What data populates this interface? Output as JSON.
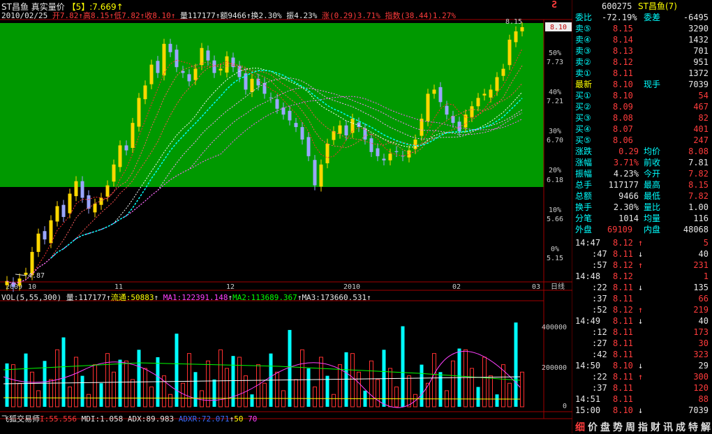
{
  "header": {
    "stock_name": "ST昌鱼",
    "mode": "真实量价",
    "bracket": "【5】",
    "bracket_val": ":7.669",
    "date": "2010/02/25",
    "open_l": "开",
    "open": "7.82",
    "high_l": "高",
    "high": "8.15",
    "low_l": "低",
    "low": "7.82",
    "close_l": "收",
    "close": "8.10",
    "vol_l": "量",
    "vol": "117177",
    "amt_l": "额",
    "amt": "9466",
    "turn_l": "换",
    "turn": "2.30%",
    "amp_l": "振",
    "amp": "4.23%",
    "chg_l": "涨",
    "chg": "(0.29)",
    "chg_pct": "3.71%",
    "idx_l": "指数",
    "idx": "(38.44)",
    "idx_pct": "1.27%"
  },
  "price_axis": {
    "labels": [
      "8.15",
      "7.73",
      "7.21",
      "6.70",
      "6.18",
      "5.66",
      "5.15"
    ],
    "pct": [
      "50%",
      "40%",
      "30%",
      "20%",
      "10%",
      "0%"
    ],
    "current": "8.10"
  },
  "date_axis": {
    "labels": [
      "2009",
      "10",
      "11",
      "12",
      "2010",
      "02",
      "03"
    ],
    "period": "日线"
  },
  "annotations": {
    "low": "4.87",
    "high": "8.15"
  },
  "vol_header": {
    "title": "VOL(5,55,300)",
    "vol_l": "量:",
    "vol": "117177",
    "float_l": "流通:",
    "float": "50883",
    "ma1_l": "MA1:",
    "ma1": "122391.148",
    "ma2_l": "MA2:",
    "ma2": "113689.367",
    "ma3_l": "MA3:",
    "ma3": "173660.531"
  },
  "vol_axis": [
    "400000",
    "200000",
    "0"
  ],
  "bottom_indicator": {
    "name": "飞狐交易师",
    "i_l": "I:",
    "i": "55.556",
    "mdi_l": "MDI:",
    "mdi": "1.058",
    "adx_l": "ADX:",
    "adx": "89.983",
    "adxr_l": "ADXR:",
    "adxr": "72.071",
    "v1": "50",
    "v2": "70"
  },
  "quote": {
    "code": "600275",
    "name": "ST昌鱼(7)",
    "weibi_l": "委比",
    "weibi": "-72.19%",
    "weicha_l": "委差",
    "weicha": "-6495",
    "asks": [
      {
        "l": "卖⑤",
        "p": "8.15",
        "v": "3290"
      },
      {
        "l": "卖④",
        "p": "8.14",
        "v": "1432"
      },
      {
        "l": "卖③",
        "p": "8.13",
        "v": "701"
      },
      {
        "l": "卖②",
        "p": "8.12",
        "v": "951"
      },
      {
        "l": "卖①",
        "p": "8.11",
        "v": "1372"
      }
    ],
    "last_l": "最新",
    "last": "8.10",
    "now_l": "现手",
    "now": "7039",
    "bids": [
      {
        "l": "买①",
        "p": "8.10",
        "v": "54"
      },
      {
        "l": "买②",
        "p": "8.09",
        "v": "467"
      },
      {
        "l": "买③",
        "p": "8.08",
        "v": "82"
      },
      {
        "l": "买④",
        "p": "8.07",
        "v": "401"
      },
      {
        "l": "买⑤",
        "p": "8.06",
        "v": "247"
      }
    ],
    "stats": [
      {
        "a": "涨跌",
        "av": "0.29",
        "b": "均价",
        "bv": "8.08",
        "ac": "t-red",
        "bc": "t-red"
      },
      {
        "a": "涨幅",
        "av": "3.71%",
        "b": "前收",
        "bv": "7.81",
        "ac": "t-red",
        "bc": "t-white"
      },
      {
        "a": "振幅",
        "av": "4.23%",
        "b": "今开",
        "bv": "7.82",
        "ac": "t-white",
        "bc": "t-red"
      },
      {
        "a": "总手",
        "av": "117177",
        "b": "最高",
        "bv": "8.15",
        "ac": "t-white",
        "bc": "t-red"
      },
      {
        "a": "总额",
        "av": "9466",
        "b": "最低",
        "bv": "7.82",
        "ac": "t-white",
        "bc": "t-red"
      },
      {
        "a": "换手",
        "av": "2.30%",
        "b": "量比",
        "bv": "1.00",
        "ac": "t-white",
        "bc": "t-white"
      },
      {
        "a": "分笔",
        "av": "1014",
        "b": "均量",
        "bv": "116",
        "ac": "t-white",
        "bc": "t-white"
      }
    ],
    "outer_l": "外盘",
    "outer": "69109",
    "inner_l": "内盘",
    "inner": "48068"
  },
  "ticks": [
    {
      "t": "14:47",
      "p": "8.12",
      "d": "↑",
      "v": "5"
    },
    {
      "t": ":47",
      "p": "8.11",
      "d": "↓",
      "v": "40"
    },
    {
      "t": ":57",
      "p": "8.12",
      "d": "↑",
      "v": "231"
    },
    {
      "t": "14:48",
      "p": "8.12",
      "d": "",
      "v": "1"
    },
    {
      "t": ":22",
      "p": "8.11",
      "d": "↓",
      "v": "135"
    },
    {
      "t": ":37",
      "p": "8.11",
      "d": "",
      "v": "66"
    },
    {
      "t": ":52",
      "p": "8.12",
      "d": "↑",
      "v": "219"
    },
    {
      "t": "14:49",
      "p": "8.11",
      "d": "↓",
      "v": "40"
    },
    {
      "t": ":12",
      "p": "8.11",
      "d": "",
      "v": "173"
    },
    {
      "t": ":27",
      "p": "8.11",
      "d": "",
      "v": "30"
    },
    {
      "t": ":42",
      "p": "8.11",
      "d": "",
      "v": "323"
    },
    {
      "t": "14:50",
      "p": "8.10",
      "d": "↓",
      "v": "29"
    },
    {
      "t": ":22",
      "p": "8.11",
      "d": "↑",
      "v": "300"
    },
    {
      "t": ":37",
      "p": "8.11",
      "d": "",
      "v": "120"
    },
    {
      "t": "14:51",
      "p": "8.11",
      "d": "",
      "v": "88"
    },
    {
      "t": "15:00",
      "p": "8.10",
      "d": "↓",
      "v": "7039"
    }
  ],
  "tabs": [
    "细",
    "价",
    "盘",
    "势",
    "周",
    "指",
    "财",
    "讯",
    "成",
    "特",
    "解"
  ],
  "icon_text": "Ƨ",
  "colors": {
    "green_zone": "#009900",
    "up": "#ffd700",
    "down": "#9aa6ff",
    "red": "#ff3c3c",
    "grid": "#a00000"
  }
}
